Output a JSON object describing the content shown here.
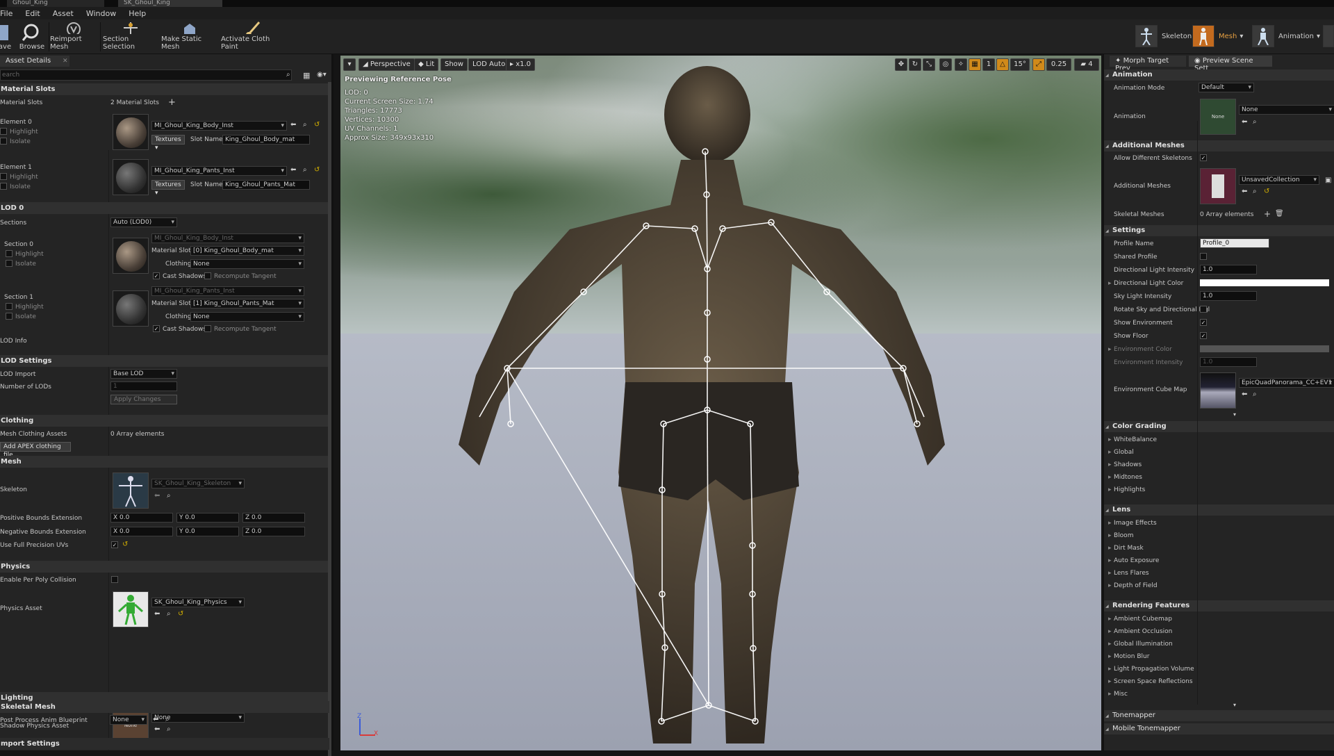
{
  "doc_tabs": [
    "Ghoul_King",
    "SK_Ghoul_King"
  ],
  "menu": [
    "File",
    "Edit",
    "Asset",
    "Window",
    "Help"
  ],
  "toolbar": {
    "buttons": [
      "ave",
      "Browse",
      "Reimport Mesh",
      "Section Selection",
      "Make Static Mesh",
      "Activate Cloth Paint"
    ],
    "modes": [
      "Skeleton",
      "Mesh",
      "Animation"
    ]
  },
  "left": {
    "tab": "Asset Details",
    "search_placeholder": "earch",
    "material_slots": {
      "title": "Material Slots",
      "label": "Material Slots",
      "count": "2 Material Slots",
      "elements": [
        {
          "name": "Element 0",
          "material": "MI_Ghoul_King_Body_Inst",
          "textures": "Textures",
          "slot_label": "Slot Name",
          "slot": "King_Ghoul_Body_mat"
        },
        {
          "name": "Element 1",
          "material": "MI_Ghoul_King_Pants_Inst",
          "textures": "Textures",
          "slot_label": "Slot Name",
          "slot": "King_Ghoul_Pants_Mat"
        }
      ],
      "highlight": "Highlight",
      "isolate": "Isolate"
    },
    "lod0": {
      "title": "LOD 0",
      "sections_label": "Sections",
      "sections_value": "Auto (LOD0)",
      "sections": [
        {
          "name": "Section 0",
          "material": "MI_Ghoul_King_Body_Inst",
          "slot": "[0] King_Ghoul_Body_mat"
        },
        {
          "name": "Section 1",
          "material": "MI_Ghoul_King_Pants_Inst",
          "slot": "[1] King_Ghoul_Pants_Mat"
        }
      ],
      "material_slot_label": "Material Slot",
      "clothing_label": "Clothing",
      "clothing_value": "None",
      "cast_shadows": "Cast Shadows",
      "recompute_tangent": "Recompute Tangent",
      "lod_info": "LOD Info"
    },
    "lod_settings": {
      "title": "LOD Settings",
      "lod_import_label": "LOD Import",
      "lod_import_value": "Base LOD",
      "num_lods_label": "Number of LODs",
      "num_lods_value": "1",
      "apply": "Apply Changes"
    },
    "clothing": {
      "title": "Clothing",
      "assets_label": "Mesh Clothing Assets",
      "assets_value": "0 Array elements",
      "add_button": "Add APEX clothing file..."
    },
    "mesh": {
      "title": "Mesh",
      "skeleton_label": "Skeleton",
      "skeleton_value": "SK_Ghoul_King_Skeleton",
      "pos_bounds_label": "Positive Bounds Extension",
      "neg_bounds_label": "Negative Bounds Extension",
      "bounds": [
        "X  0.0",
        "Y  0.0",
        "Z  0.0"
      ],
      "full_prec_label": "Use Full Precision UVs"
    },
    "physics": {
      "title": "Physics",
      "per_poly_label": "Enable Per Poly Collision",
      "asset_label": "Physics Asset",
      "asset_value": "SK_Ghoul_King_Physics"
    },
    "lighting": {
      "title": "Lighting",
      "shadow_label": "Shadow Physics Asset",
      "shadow_value": "None",
      "thumb_none": "None"
    },
    "skeletal_mesh": {
      "title": "Skeletal Mesh",
      "pp_label": "Post Process Anim Blueprint",
      "pp_value": "None"
    },
    "import_settings": "mport Settings"
  },
  "viewport": {
    "perspective": "Perspective",
    "lit": "Lit",
    "show": "Show",
    "lod": "LOD Auto",
    "speed": "x1.0",
    "angle": "15°",
    "grid": "1",
    "scale": "0.25",
    "cam": "4",
    "preview_label": "Previewing Reference Pose",
    "stats": [
      "LOD: 0",
      "Current Screen Size: 1.74",
      "Triangles: 17773",
      "Vertices: 10300",
      "UV Channels: 1",
      "Approx Size: 349x93x310"
    ],
    "axis_z": "Z",
    "axis_x": "X"
  },
  "right": {
    "tabs": [
      "Morph Target Prev",
      "Preview Scene Sett"
    ],
    "animation": {
      "title": "Animation",
      "mode_label": "Animation Mode",
      "mode_value": "Default",
      "anim_label": "Animation",
      "anim_value": "None",
      "thumb_none": "None"
    },
    "additional": {
      "title": "Additional Meshes",
      "allow_label": "Allow Different Skeletons",
      "meshes_label": "Additional Meshes",
      "meshes_value": "UnsavedCollection",
      "skel_label": "Skeletal Meshes",
      "skel_value": "0 Array elements"
    },
    "settings": {
      "title": "Settings",
      "profile_label": "Profile Name",
      "profile_value": "Profile_0",
      "shared_label": "Shared Profile",
      "dir_int_label": "Directional Light Intensity",
      "dir_int_value": "1.0",
      "dir_color_label": "Directional Light Color",
      "sky_label": "Sky Light Intensity",
      "sky_value": "1.0",
      "rotate_label": "Rotate Sky and Directional Ligl",
      "show_env_label": "Show Environment",
      "show_floor_label": "Show Floor",
      "env_color_label": "Environment Color",
      "env_int_label": "Environment Intensity",
      "env_int_value": "1.0",
      "cube_label": "Environment Cube Map",
      "cube_value": "EpicQuadPanorama_CC+EV1"
    },
    "color_grading": {
      "title": "Color Grading",
      "items": [
        "WhiteBalance",
        "Global",
        "Shadows",
        "Midtones",
        "Highlights"
      ]
    },
    "lens": {
      "title": "Lens",
      "items": [
        "Image Effects",
        "Bloom",
        "Dirt Mask",
        "Auto Exposure",
        "Lens Flares",
        "Depth of Field"
      ]
    },
    "rendering": {
      "title": "Rendering Features",
      "items": [
        "Ambient Cubemap",
        "Ambient Occlusion",
        "Global Illumination",
        "Motion Blur",
        "Light Propagation Volume",
        "Screen Space Reflections",
        "Misc"
      ]
    },
    "tonemapper": "Tonemapper",
    "mobile_tonemapper": "Mobile Tonemapper"
  }
}
